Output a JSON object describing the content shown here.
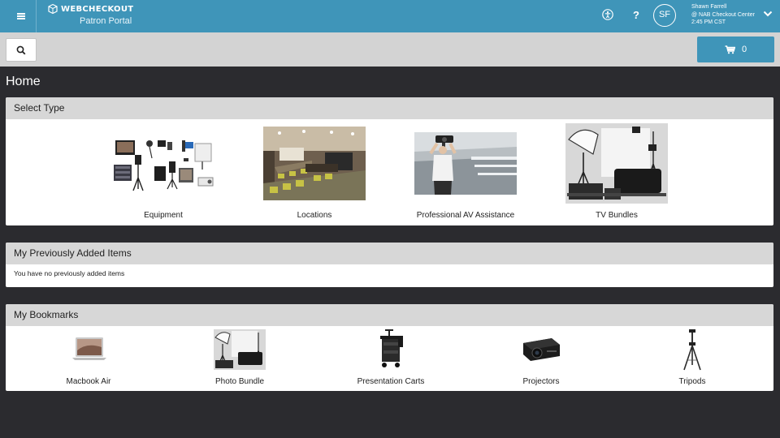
{
  "header": {
    "brand": "WEBCHECKOUT",
    "portal": "Patron Portal",
    "user_name": "Shawn Farrell",
    "user_location": "@ NAB Checkout Center",
    "user_time": "2:45 PM CST",
    "avatar_initials": "SF",
    "help_label": "?"
  },
  "toolbar": {
    "cart_count": "0"
  },
  "page": {
    "title": "Home"
  },
  "select_type": {
    "heading": "Select Type",
    "items": [
      {
        "label": "Equipment"
      },
      {
        "label": "Locations"
      },
      {
        "label": "Professional AV Assistance"
      },
      {
        "label": "TV Bundles"
      }
    ]
  },
  "previous": {
    "heading": "My Previously Added Items",
    "empty": "You have no previously added items"
  },
  "bookmarks": {
    "heading": "My Bookmarks",
    "items": [
      {
        "label": "Macbook Air"
      },
      {
        "label": "Photo Bundle"
      },
      {
        "label": "Presentation Carts"
      },
      {
        "label": "Projectors"
      },
      {
        "label": "Tripods"
      }
    ]
  },
  "colors": {
    "brand": "#3f95b9",
    "background": "#2b2b2f",
    "panel_header": "#d7d7d7"
  }
}
